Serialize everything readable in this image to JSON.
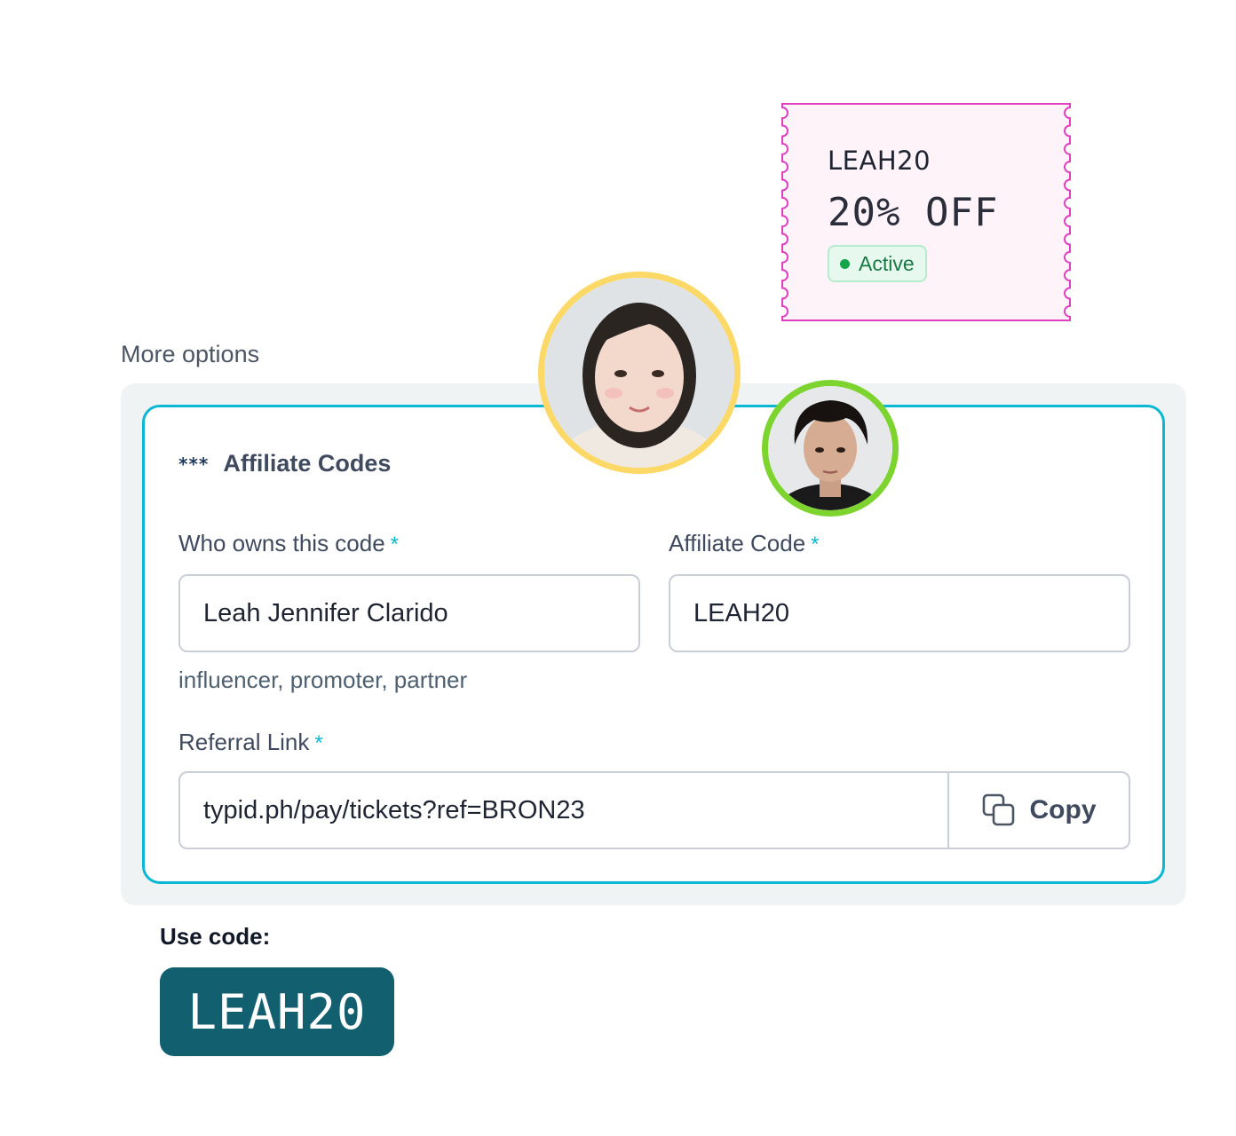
{
  "coupon": {
    "code": "LEAH20",
    "discount": "20% OFF",
    "status": "Active",
    "colors": {
      "border": "#e040c0",
      "background": "#fff3fa",
      "status": "#16a34a"
    }
  },
  "section": {
    "label": "More options"
  },
  "affiliate": {
    "title": "Affiliate Codes",
    "title_icon": "***",
    "owner": {
      "label": "Who owns this code",
      "required": "*",
      "value": "Leah Jennifer Clarido",
      "hint": "influencer, promoter, partner"
    },
    "code": {
      "label": "Affiliate Code",
      "required": "*",
      "value": "LEAH20"
    },
    "referral": {
      "label": "Referral Link",
      "required": "*",
      "value": "typid.ph/pay/tickets?ref=BRON23",
      "copy_label": "Copy",
      "copy_icon": "copy-icon"
    }
  },
  "avatars": [
    {
      "name": "avatar-woman",
      "ring_color": "#fcd966"
    },
    {
      "name": "avatar-man",
      "ring_color": "#7ed42e"
    }
  ],
  "use_code": {
    "label": "Use code:",
    "code": "LEAH20",
    "color": "#125f70"
  },
  "accent": "#0ab8d3"
}
